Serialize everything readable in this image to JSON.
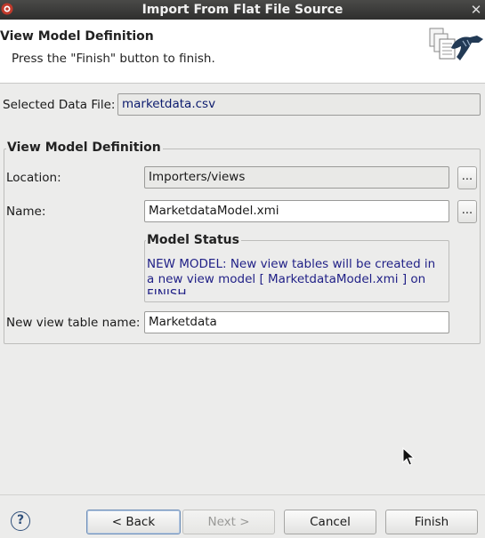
{
  "window": {
    "title": "Import From Flat File Source",
    "close_glyph": "✕"
  },
  "header": {
    "title": "View Model Definition",
    "message": "Press the \"Finish\" button to finish."
  },
  "selected_file": {
    "label": "Selected Data File:",
    "value": "marketdata.csv"
  },
  "view_model_group": {
    "title": "View Model Definition",
    "location": {
      "label": "Location:",
      "value": "Importers/views",
      "browse_label": "..."
    },
    "name": {
      "label": "Name:",
      "value": "MarketdataModel.xmi",
      "browse_label": "..."
    },
    "model_status": {
      "title": "Model Status",
      "text": "NEW MODEL: New view tables will be created in a new view model [ MarketdataModel.xmi ] on FINISH"
    },
    "table_name": {
      "label": "New view table name:",
      "value": "Marketdata"
    }
  },
  "buttons": {
    "help": "?",
    "back": "< Back",
    "next": "Next >",
    "cancel": "Cancel",
    "finish": "Finish"
  },
  "icons": {
    "app": "teiid-app-icon",
    "wizard": "document-stack-wizard-icon",
    "help": "help-icon",
    "cursor": "mouse-pointer-icon"
  },
  "colors": {
    "titlebar": "#3a3a39",
    "background": "#ececeb",
    "status_text": "#1f1f86",
    "file_value": "#0c1b6e"
  }
}
